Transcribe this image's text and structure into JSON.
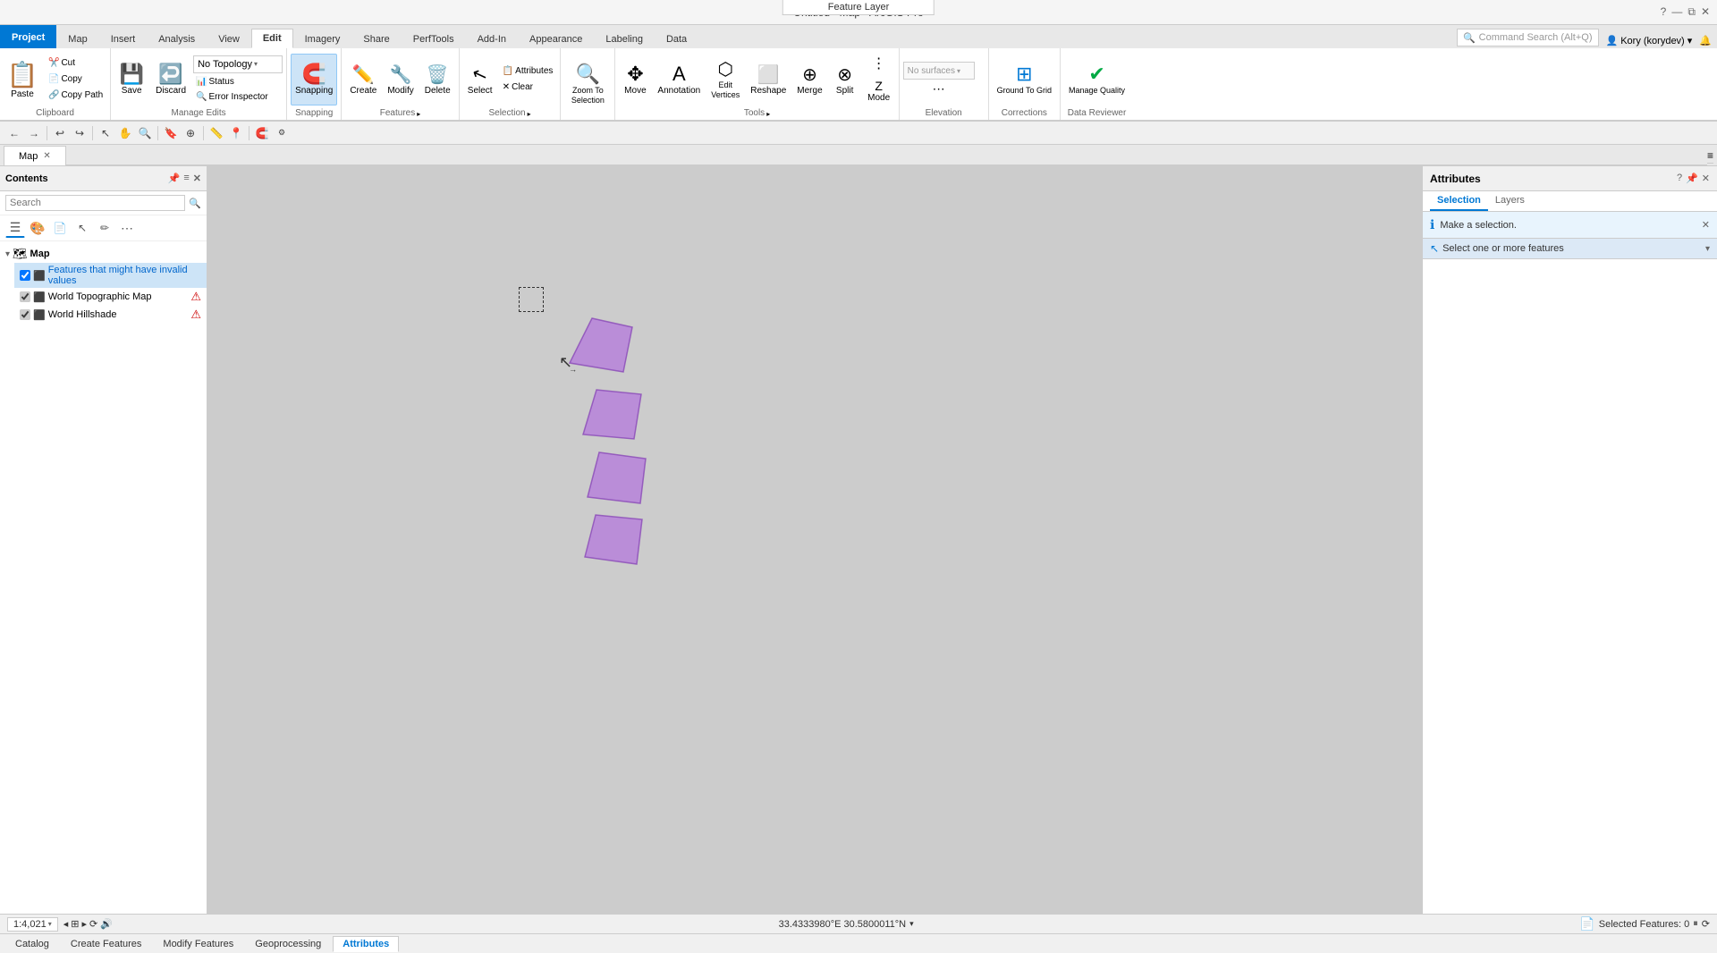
{
  "window": {
    "title": "Untitled - Map - ArcGIS Pro",
    "feature_layer_label": "Feature Layer"
  },
  "tabs": {
    "items": [
      {
        "label": "Project",
        "type": "project"
      },
      {
        "label": "Map"
      },
      {
        "label": "Insert"
      },
      {
        "label": "Analysis"
      },
      {
        "label": "View"
      },
      {
        "label": "Edit",
        "active": true
      },
      {
        "label": "Imagery"
      },
      {
        "label": "Share"
      },
      {
        "label": "PerfTools"
      },
      {
        "label": "Add-In"
      },
      {
        "label": "Appearance"
      },
      {
        "label": "Labeling"
      },
      {
        "label": "Data"
      }
    ]
  },
  "ribbon": {
    "clipboard": {
      "label": "Clipboard",
      "paste": "Paste",
      "cut": "Cut",
      "copy": "Copy",
      "copy_path": "Copy Path"
    },
    "manage_edits": {
      "label": "Manage Edits",
      "save": "Save",
      "discard": "Discard",
      "topology_label": "No Topology",
      "status": "Status",
      "error_inspector": "Error Inspector"
    },
    "snapping": {
      "label": "Snapping",
      "snapping": "Snapping"
    },
    "features": {
      "label": "Features",
      "create": "Create",
      "modify": "Modify",
      "delete": "Delete"
    },
    "selection": {
      "label": "Selection",
      "select": "Select",
      "attributes": "Attributes",
      "clear": "Clear"
    },
    "zoom_selection": {
      "label": "Zoom to Selection",
      "zoom": "Zoom To\nSelection"
    },
    "tools": {
      "label": "Tools",
      "move": "Move",
      "annotation": "Annotation",
      "edit_vertices": "Edit\nVertices",
      "reshape": "Reshape",
      "merge": "Merge",
      "split": "Split",
      "mode": "Mode"
    },
    "elevation": {
      "label": "Elevation",
      "no_surfaces": "No surfaces",
      "more": "..."
    },
    "corrections": {
      "label": "Corrections",
      "ground_to_grid": "Ground To Grid"
    },
    "data_reviewer": {
      "label": "Data Reviewer",
      "manage_quality": "Manage Quality"
    }
  },
  "contents": {
    "title": "Contents",
    "search_placeholder": "Search",
    "layers": [
      {
        "label": "Map",
        "type": "map",
        "expanded": true,
        "children": [
          {
            "label": "Features that might have invalid values",
            "type": "feature",
            "checked": true,
            "selected": true
          },
          {
            "label": "World Topographic Map",
            "type": "tile",
            "warning": true
          },
          {
            "label": "World Hillshade",
            "type": "tile",
            "warning": true
          }
        ]
      }
    ]
  },
  "attributes_panel": {
    "title": "Attributes",
    "tabs": [
      "Selection",
      "Layers"
    ],
    "active_tab": "Selection",
    "info_message": "Make a selection.",
    "select_placeholder": "Select one or more features"
  },
  "map": {
    "tab_label": "Map",
    "coordinate": "33.4333980°E 30.5800011°N",
    "scale": "1:4,021"
  },
  "statusbar": {
    "selected_features": "Selected Features: 0",
    "coordinate": "33.4333980°E 30.5800011°N"
  },
  "bottom_tabs": [
    "Catalog",
    "Create Features",
    "Modify Features",
    "Geoprocessing",
    "Attributes"
  ],
  "toolbar": {
    "search_command": "Command Search (Alt+Q)"
  }
}
